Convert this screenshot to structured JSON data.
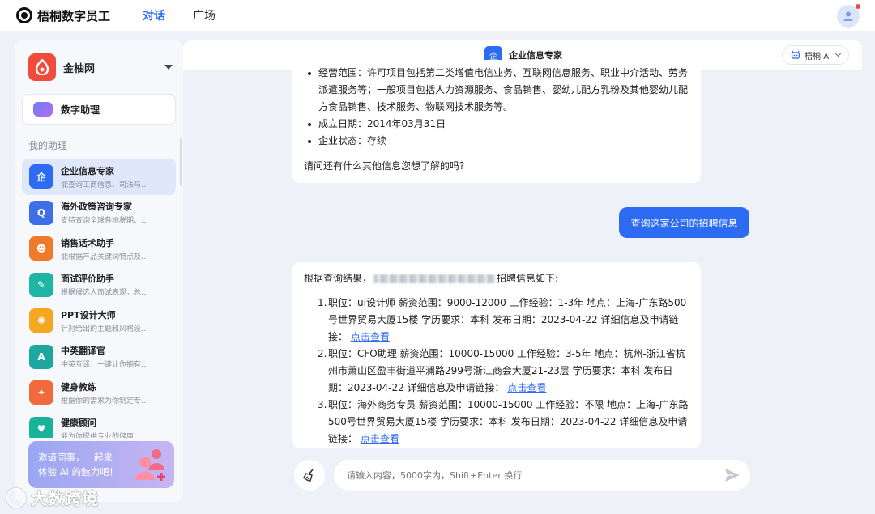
{
  "topbar": {
    "app_name": "梧桐数字员工",
    "tabs": [
      {
        "label": "对话"
      },
      {
        "label": "广场"
      }
    ]
  },
  "sidebar": {
    "org_name": "金柚网",
    "digital_assistant": "数字助理",
    "section_title": "我的助理",
    "assistants": [
      {
        "name": "企业信息专家",
        "desc": "能查询工商信息、司法与...",
        "color": "#2d6bf3",
        "icon": "enterprise-shield-icon",
        "glyph": "企"
      },
      {
        "name": "海外政策咨询专家",
        "desc": "支持查询全球各地税期、...",
        "color": "#3d6fe8",
        "icon": "globe-search-icon",
        "glyph": "Q"
      },
      {
        "name": "销售话术助手",
        "desc": "能根据产品关键词特点及...",
        "color": "#f07a2b",
        "icon": "salesperson-icon",
        "glyph": "☻"
      },
      {
        "name": "面试评价助手",
        "desc": "根据候选人面试表现，总...",
        "color": "#1fb5a4",
        "icon": "interview-form-icon",
        "glyph": "✎"
      },
      {
        "name": "PPT设计大师",
        "desc": "针对给出的主题和风格设...",
        "color": "#f5a81f",
        "icon": "ppt-design-icon",
        "glyph": "✺"
      },
      {
        "name": "中英翻译官",
        "desc": "中英互译，一键让你拥有...",
        "color": "#1ea6a0",
        "icon": "translate-icon",
        "glyph": "A"
      },
      {
        "name": "健身教练",
        "desc": "根据你的需求为你制定专...",
        "color": "#f06a3c",
        "icon": "fitness-icon",
        "glyph": "✦"
      },
      {
        "name": "健康顾问",
        "desc": "能为你提供专业的健康...",
        "color": "#18b39a",
        "icon": "health-heart-icon",
        "glyph": "♥"
      }
    ],
    "invite": {
      "line1": "邀请同事，一起来",
      "line2": "体验 AI 的魅力吧！"
    }
  },
  "chat": {
    "title": "企业信息专家",
    "model": "梧桐 AI",
    "msg1": {
      "items": [
        "经营范围：许可项目包括第二类增值电信业务、互联网信息服务、职业中介活动、劳务派遣服务等；一般项目包括人力资源服务、食品销售、婴幼儿配方乳粉及其他婴幼儿配方食品销售、技术服务、物联网技术服务等。",
        "成立日期：2014年03月31日",
        "企业状态：存续"
      ],
      "question": "请问还有什么其他信息您想了解的吗?"
    },
    "user_msg": "查询这家公司的招聘信息",
    "msg2": {
      "intro_prefix": "根据查询结果，",
      "intro_suffix": "招聘信息如下:",
      "jobs": [
        {
          "n": "1.",
          "text": "职位：ui设计师 薪资范围：9000-12000 工作经验：1-3年 地点：上海-广东路500号世界贸易大厦15楼 学历要求：本科 发布日期：2023-04-22 详细信息及申请链接： ",
          "link": "点击查看"
        },
        {
          "n": "2.",
          "text": "职位：CFO助理 薪资范围：10000-15000 工作经验：3-5年 地点：杭州-浙江省杭州市萧山区盈丰街道平澜路299号浙江商会大厦21-23层 学历要求：本科 发布日期：2023-04-22 详细信息及申请链接： ",
          "link": "点击查看"
        },
        {
          "n": "3.",
          "text": "职位：海外商务专员 薪资范围：10000-15000 工作经验：不限 地点：上海-广东路500号世界贸易大厦15楼 学历要求：本科 发布日期：2023-04-22 详细信息及申请链接： ",
          "link": "点击查看"
        }
      ]
    },
    "input_placeholder": "请输入内容，5000字内，Shift+Enter 换行"
  },
  "watermark": "大数跨境"
}
